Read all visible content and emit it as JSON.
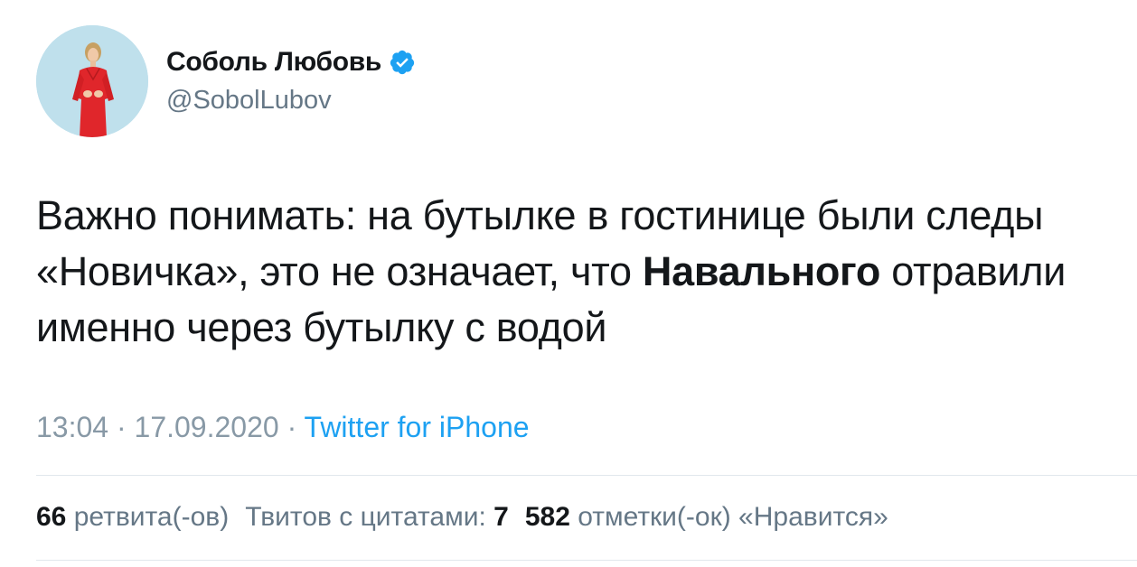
{
  "author": {
    "display_name": "Соболь Любовь",
    "handle": "@SobolLubov",
    "verified_icon": "verified-badge-icon"
  },
  "tweet": {
    "lines": [
      "Важно понимать: на бутылке в гостинице были следы",
      "«Новичка», это не означает, что ",
      "Навального",
      " отравили",
      "именно через бутылку с водой"
    ]
  },
  "meta": {
    "time": "13:04",
    "separator1": " · ",
    "date": "17.09.2020",
    "separator2": " · ",
    "source": "Twitter for iPhone"
  },
  "stats": {
    "retweets_count": "66",
    "retweets_label": "ретвита(-ов)",
    "quotes_label": "Твитов с цитатами:",
    "quotes_count": "7",
    "likes_count": "582",
    "likes_label": "отметки(-ок) «Нравится»"
  },
  "colors": {
    "text": "#14171a",
    "secondary": "#657786",
    "meta": "#8899a6",
    "link": "#1da1f2",
    "divider": "#e1e8ed",
    "avatar_bg": "#bfe0ec",
    "dress": "#e0262b"
  }
}
